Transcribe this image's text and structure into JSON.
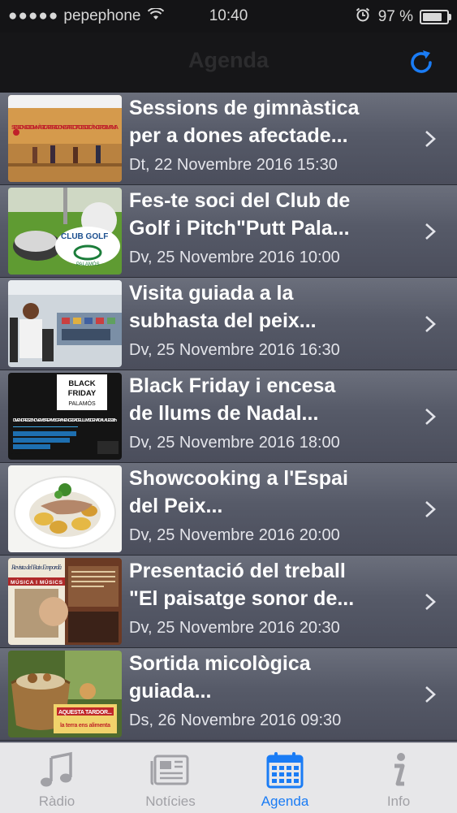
{
  "status_bar": {
    "carrier": "pepephone",
    "time": "10:40",
    "battery": "97 %",
    "battery_level": 0.97
  },
  "nav": {
    "title": "Agenda",
    "refresh_icon": "refresh-icon",
    "accent_color": "#1a7cf5"
  },
  "events": [
    {
      "title_line1": "Sessions de gimnàstica",
      "title_line2": "per a dones afectade...",
      "date": "Dt, 22 Novembre 2016 15:30",
      "thumb_text": "SESSIONS DE GIMNÀSTICA PER A DONES AFECTADES DE CÀNCER DE MAMA"
    },
    {
      "title_line1": "Fes-te soci del Club de",
      "title_line2": "Golf i Pitch\"Putt Pala...",
      "date": "Dv, 25 Novembre 2016 10:00",
      "thumb_text": "CLUB GOLF",
      "thumb_subtext": "PALAMÓS"
    },
    {
      "title_line1": "Visita guiada a la",
      "title_line2": "subhasta del peix...",
      "date": "Dv, 25 Novembre 2016 16:30"
    },
    {
      "title_line1": "Black Friday i encesa",
      "title_line2": "de llums de Nadal...",
      "date": "Dv, 25 Novembre 2016 18:00",
      "thumb_text": "BLACK FRIDAY PALAMÓS",
      "thumb_subtext": "DIVENDRES 25 NOVEMBRE AMB GRAN ENCESA DE LLUMS DE NADAL A LES 18h"
    },
    {
      "title_line1": "Showcooking a l'Espai",
      "title_line2": "del Peix...",
      "date": "Dv, 25 Novembre 2016 20:00"
    },
    {
      "title_line1": "Presentació del treball",
      "title_line2": "\"El paisatge sonor de...",
      "date": "Dv, 25 Novembre 2016 20:30",
      "thumb_text": "Revista del Baix Empordà",
      "thumb_subtext": "MÚSICA I MÚSICS"
    },
    {
      "title_line1": "Sortida micològica",
      "title_line2": "guiada...",
      "date": "Ds, 26 Novembre 2016 09:30",
      "thumb_text": "AQUESTA TARDOR...",
      "thumb_subtext": "la terra ens alimenta"
    }
  ],
  "tabs": [
    {
      "label": "Ràdio",
      "icon": "music-note-icon",
      "active": false
    },
    {
      "label": "Notícies",
      "icon": "newspaper-icon",
      "active": false
    },
    {
      "label": "Agenda",
      "icon": "calendar-icon",
      "active": true
    },
    {
      "label": "Info",
      "icon": "info-icon",
      "active": false
    }
  ]
}
